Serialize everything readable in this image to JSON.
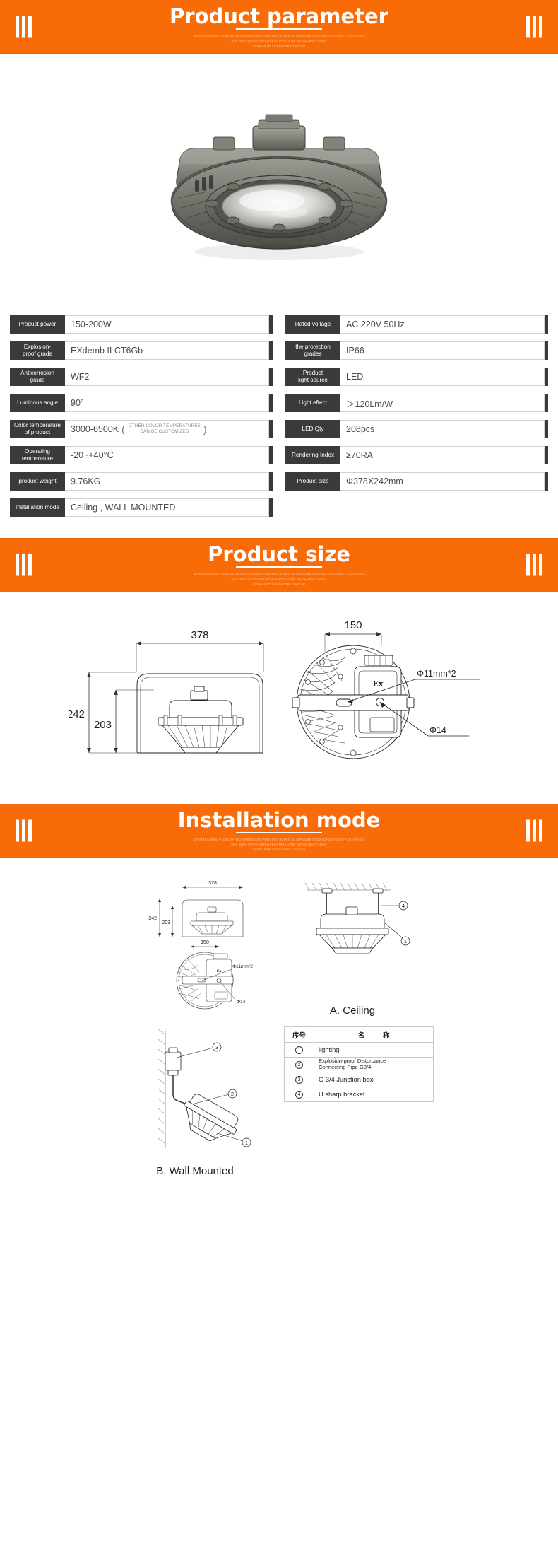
{
  "sections": {
    "parameter": {
      "title": "Product parameter",
      "subtitle_line1": "CNSFJKALHFSDFNSDJKFHSDJKFBSD HSDIFHDSUIKFSDHFS ADSUFGDSK FDGSYUFGSFGSDIFFJSID FHSD",
      "subtitle_line2": "SDF SDFIHDFUIVHSFKHSKLV DFHUIVRE BVFSDJKVAYUGHS",
      "subtitle_line3": "FHSDUIFHNSIJDSLFHSKH DIFQH"
    },
    "size": {
      "title": "Product size",
      "subtitle_line1": "CNSFJKALHFSDFNSDJKFHSDJKFBSD HSDIFHDSUIKFSDHFS ADSUFGDSK FDGSYUFGSFGSDIFFJSID FHSD",
      "subtitle_line2": "SDF SDFIHDFUIVHSFKHSKLV DFHUIVRE BVFSDJKVAYUGHS",
      "subtitle_line3": "FHSDUIFHNSIJDSLFHSKH DIFQH"
    },
    "installation": {
      "title": "Installation mode",
      "subtitle_line1": "CNSFJKALHFSDFNSDJKFHSDJKFBSD HSDIFHDSUIKFSDHFS ADSUFGDSK FDGSYUFGSFGSDIFFJSID FHSD",
      "subtitle_line2": "SDF SDFIHDFUIVHSFKHSKLV DFHUIVRE BVFSDJKVAYUGHS",
      "subtitle_line3": "FHSDUIFHNSIJDSLFHSKH DIFQH"
    }
  },
  "parameters": {
    "left": [
      {
        "key": "Product power",
        "value": "150-200W"
      },
      {
        "key": "Explosion-\nproof grade",
        "value": "EXdemb II CT6Gb"
      },
      {
        "key": "Anticorrosion\ngrade",
        "value": "WF2"
      },
      {
        "key": "Luminous angle",
        "value": "90°"
      },
      {
        "key": "Color temperature\nof product",
        "value": "3000-6500K",
        "note_line1": "OTHER COLOR TEMPERATURES",
        "note_line2": "CAN BE CUSTOMIZED"
      },
      {
        "key": "Operating\ntemperature",
        "value": "-20~+40°C"
      },
      {
        "key": "product weight",
        "value": "9.76KG"
      },
      {
        "key": "Installation mode",
        "value": "Ceiling , WALL MOUNTED"
      }
    ],
    "right": [
      {
        "key": "Rated voltage",
        "value": "AC 220V  50Hz"
      },
      {
        "key": "the protection\ngrades",
        "value": "IP66"
      },
      {
        "key": "Product\nlight source",
        "value": "LED"
      },
      {
        "key": "Light effect",
        "value": "＞120Lm/W"
      },
      {
        "key": "LED  Qty",
        "value": "208pcs"
      },
      {
        "key": "Rendering Index",
        "value": "≥70RA"
      },
      {
        "key": "Product size",
        "value": "Φ378X242mm"
      }
    ]
  },
  "size_drawing": {
    "side_view": {
      "width_label": "378",
      "height_outer_label": "242",
      "height_inner_label": "203"
    },
    "bottom_view": {
      "width_label": "150",
      "hole_label": "Φ11mm*2",
      "center_hole_label": "Φ14",
      "body_mark": "Ex"
    }
  },
  "installation_drawing": {
    "ceiling": {
      "caption": "A. Ceiling",
      "side_width_label": "378",
      "side_height_outer_label": "242",
      "side_height_inner_label": "203",
      "bottom_width_label": "150",
      "hole_label": "Φ11mm*2",
      "center_hole_label": "Φ14",
      "body_mark": "Ex",
      "callouts": [
        "①",
        "④"
      ]
    },
    "wall": {
      "caption": "B. Wall Mounted",
      "callouts": [
        "①",
        "②",
        "③"
      ]
    }
  },
  "legend": {
    "header_no": "序号",
    "header_name_left": "名",
    "header_name_right": "称",
    "rows": [
      {
        "no": "①",
        "name": "lighting",
        "multiline": false
      },
      {
        "no": "②",
        "name_line1": "Explosion-proof Disturbance",
        "name_line2": "Connecting Pipe G3/4",
        "multiline": true
      },
      {
        "no": "③",
        "name": "G 3/4 Junction box",
        "multiline": false
      },
      {
        "no": "④",
        "name": "U sharp bracket",
        "multiline": false
      }
    ]
  },
  "colors": {
    "banner_orange": "#f96b07",
    "key_dark": "#3a3a3a",
    "subtitle_tint": "#ffc59b"
  }
}
